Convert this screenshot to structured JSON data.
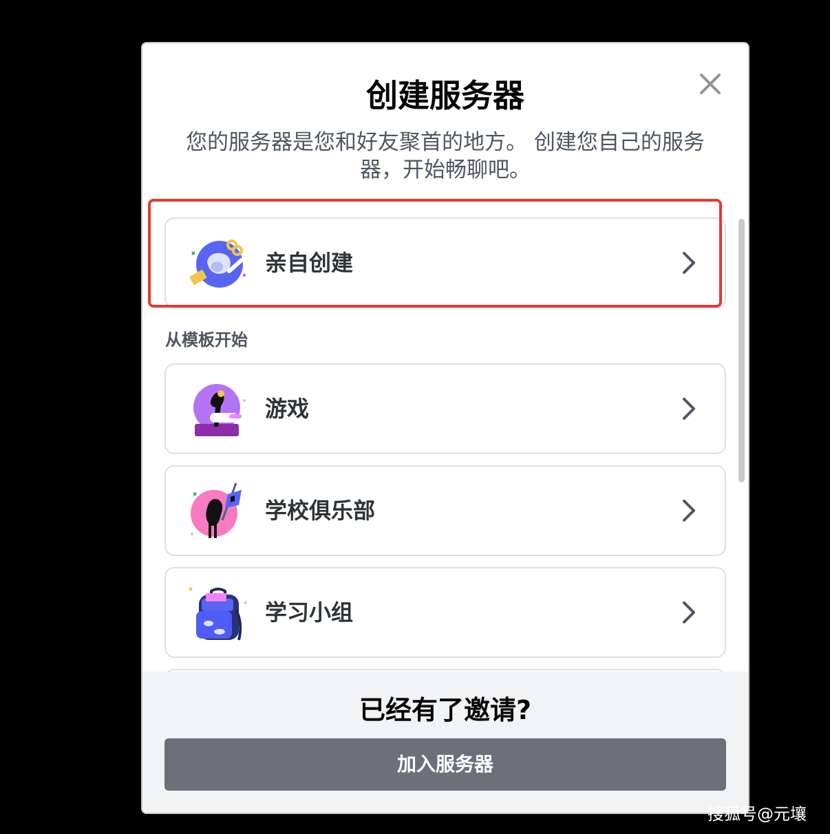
{
  "modal": {
    "title": "创建服务器",
    "subtitle": "您的服务器是您和好友聚首的地方。 创建您自己的服务器，开始畅聊吧。",
    "close_icon": "close-icon"
  },
  "create_own": {
    "label": "亲自创建",
    "icon": "create-own-illustration",
    "highlight_color": "#e8392f"
  },
  "templates": {
    "section_label": "从模板开始",
    "items": [
      {
        "label": "游戏",
        "icon": "gaming-illustration"
      },
      {
        "label": "学校俱乐部",
        "icon": "school-club-illustration"
      },
      {
        "label": "学习小组",
        "icon": "study-group-illustration"
      }
    ]
  },
  "footer": {
    "title": "已经有了邀请?",
    "join_button": "加入服务器",
    "button_color": "#6d7079"
  },
  "watermark": "搜狐号@元壤"
}
